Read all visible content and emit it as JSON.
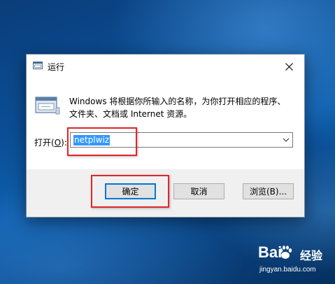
{
  "dialog": {
    "title": "运行",
    "description": "Windows 将根据你所输入的名称，为你打开相应的程序、文件夹、文档或 Internet 资源。",
    "open_label_prefix": "打开(",
    "open_label_key": "O",
    "open_label_suffix": "):",
    "input_value": "netplwiz",
    "buttons": {
      "ok": "确定",
      "cancel": "取消",
      "browse": "浏览(B)..."
    }
  },
  "watermark": {
    "brand_left": "Bai",
    "brand_right": "经验",
    "url": "jingyan.baidu.com"
  },
  "colors": {
    "highlight": "#e0262a",
    "selection": "#3399ff",
    "ok_focus": "#0078d7"
  },
  "icons": [
    "run-app-icon",
    "close-icon",
    "run-program-icon",
    "dropdown-arrow-icon",
    "baidu-paw-icon"
  ]
}
